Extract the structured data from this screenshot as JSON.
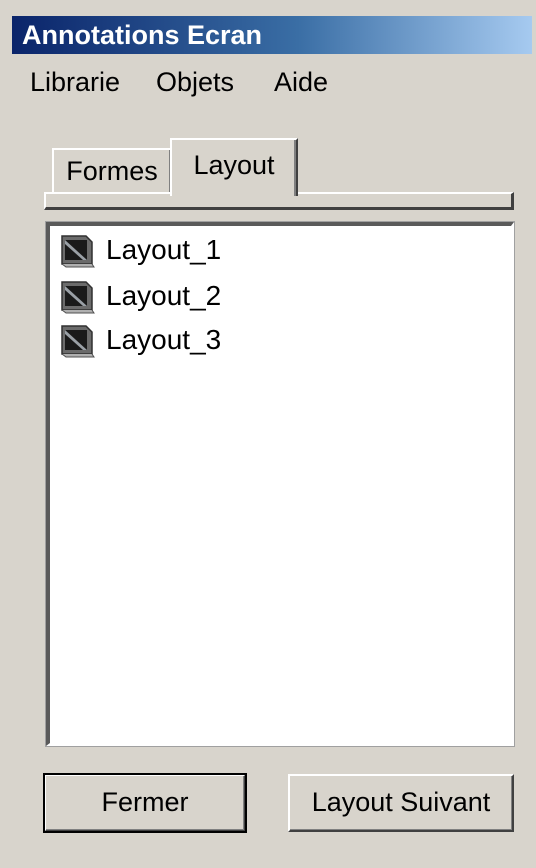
{
  "window": {
    "title": "Annotations Ecran"
  },
  "menu": {
    "items": [
      "Librarie",
      "Objets",
      "Aide"
    ]
  },
  "tabs": [
    {
      "label": "Formes",
      "active": false
    },
    {
      "label": "Layout",
      "active": true
    }
  ],
  "list": {
    "icon": "layout-file-icon",
    "items": [
      "Layout_1",
      "Layout_2",
      "Layout_3"
    ]
  },
  "buttons": {
    "close_label": "Fermer",
    "next_label": "Layout Suivant"
  },
  "colors": {
    "titlebar_start": "#0a246a",
    "titlebar_end": "#a6caf0",
    "face": "#d8d4cc"
  }
}
